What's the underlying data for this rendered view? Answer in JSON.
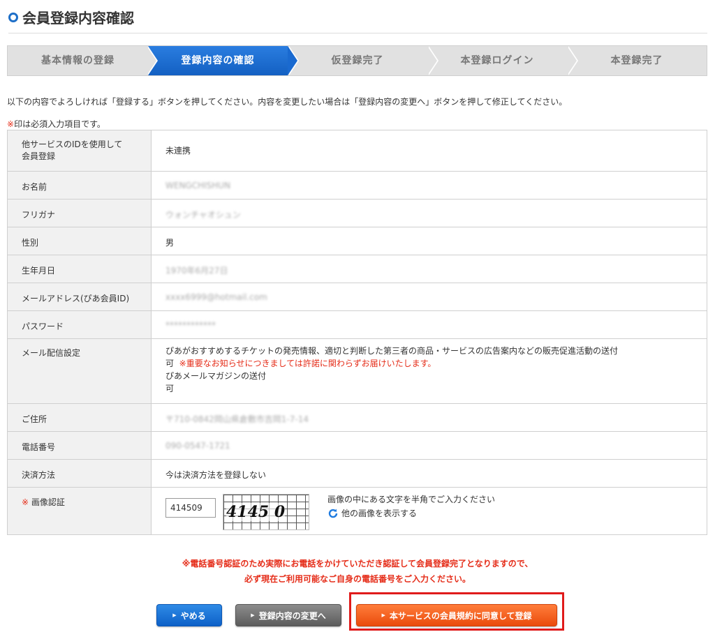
{
  "page": {
    "title": "会員登録内容確認"
  },
  "steps": [
    {
      "label": "基本情報の登録",
      "active": false
    },
    {
      "label": "登録内容の確認",
      "active": true
    },
    {
      "label": "仮登録完了",
      "active": false
    },
    {
      "label": "本登録ログイン",
      "active": false
    },
    {
      "label": "本登録完了",
      "active": false
    }
  ],
  "intro": "以下の内容でよろしければ「登録する」ボタンを押してください。内容を変更したい場合は「登録内容の変更へ」ボタンを押して修正してください。",
  "required_note": {
    "mark": "※",
    "text": "印は必須入力項目です。"
  },
  "rows": {
    "other_service": {
      "label_line1": "他サービスのIDを使用して",
      "label_line2": "会員登録",
      "value": "未連携"
    },
    "name": {
      "label": "お名前",
      "value": "WENGCHISHUN"
    },
    "furigana": {
      "label": "フリガナ",
      "value": "ウォンチャオシュン"
    },
    "gender": {
      "label": "性別",
      "value": "男"
    },
    "birthday": {
      "label": "生年月日",
      "value": "1970年6月27日"
    },
    "email": {
      "label": "メールアドレス(ぴあ会員ID)",
      "value": "xxxx6999@hotmail.com"
    },
    "password": {
      "label": "パスワード",
      "value": "************"
    },
    "mail_settings": {
      "label": "メール配信設定",
      "line1": "ぴあがおすすめするチケットの発売情報、適切と判断した第三者の商品・サービスの広告案内などの販売促進活動の送付",
      "line2_value": "可",
      "line2_note": "※重要なお知らせにつきましては許諾に関わらずお届けいたします。",
      "line3": "ぴあメールマガジンの送付",
      "line4": "可"
    },
    "address": {
      "label": "ご住所",
      "value": "〒710-0842岡山県倉敷市吉岡1-7-14"
    },
    "phone": {
      "label": "電話番号",
      "value": "090-0547-1721"
    },
    "payment": {
      "label": "決済方法",
      "value": "今は決済方法を登録しない"
    },
    "captcha": {
      "mark": "※",
      "label": "画像認証",
      "input_value": "414509",
      "image_text": "4145 0",
      "help": "画像の中にある文字を半角でご入力ください",
      "refresh_label": "他の画像を表示する"
    }
  },
  "notice": {
    "line1": "※電話番号認証のため実際にお電話をかけていただき認証して会員登録完了となりますので、",
    "line2": "必ず現在ご利用可能なご自身の電話番号をご入力ください。"
  },
  "buttons": {
    "cancel": "やめる",
    "change": "登録内容の変更へ",
    "register": "本サービスの会員規約に同意して登録"
  },
  "colors": {
    "accent": "#1e6fc8",
    "warning": "#e52c18",
    "register": "#ea4b0c",
    "highlight": "#e01b1b"
  }
}
